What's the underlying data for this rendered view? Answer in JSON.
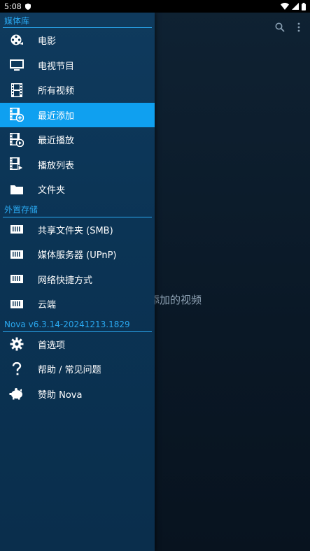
{
  "status_bar": {
    "time": "5:08"
  },
  "drawer": {
    "sections": [
      {
        "header": "媒体库",
        "items": [
          {
            "label": "电影",
            "icon": "film-reel-icon",
            "active": false
          },
          {
            "label": "电视节目",
            "icon": "tv-icon",
            "active": false
          },
          {
            "label": "所有视频",
            "icon": "filmstrip-icon",
            "active": false
          },
          {
            "label": "最近添加",
            "icon": "filmstrip-add-icon",
            "active": true
          },
          {
            "label": "最近播放",
            "icon": "filmstrip-play-icon",
            "active": false
          },
          {
            "label": "播放列表",
            "icon": "filmstrip-playlist-icon",
            "active": false
          },
          {
            "label": "文件夹",
            "icon": "folder-icon",
            "active": false
          }
        ]
      },
      {
        "header": "外置存储",
        "items": [
          {
            "label": "共享文件夹 (SMB)",
            "icon": "network-drive-icon",
            "active": false
          },
          {
            "label": "媒体服务器 (UPnP)",
            "icon": "network-drive-icon",
            "active": false
          },
          {
            "label": "网络快捷方式",
            "icon": "network-drive-icon",
            "active": false
          },
          {
            "label": "云端",
            "icon": "network-drive-icon",
            "active": false
          }
        ]
      },
      {
        "header": "Nova v6.3.14-20241213.1829",
        "items": [
          {
            "label": "首选项",
            "icon": "gear-icon",
            "active": false
          },
          {
            "label": "帮助 / 常见问题",
            "icon": "question-icon",
            "active": false
          },
          {
            "label": "赞助 Nova",
            "icon": "piggy-bank-icon",
            "active": false
          }
        ]
      }
    ]
  },
  "main": {
    "empty_text": "添加的视频"
  },
  "colors": {
    "accent": "#2aa8f0",
    "active_bg": "#0fa0f0",
    "drawer_bg": "#0b3455"
  }
}
